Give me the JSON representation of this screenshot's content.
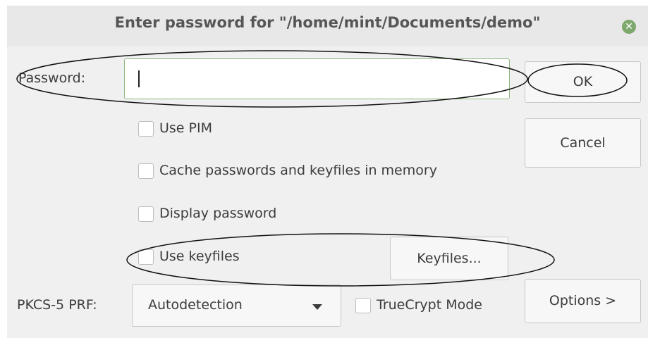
{
  "dialog": {
    "title": "Enter password for \"/home/mint/Documents/demo\"",
    "close_icon": "close-icon"
  },
  "password": {
    "label": "Password:",
    "value": ""
  },
  "buttons": {
    "ok": "OK",
    "cancel": "Cancel",
    "keyfiles": "Keyfiles...",
    "options": "Options >"
  },
  "checkboxes": {
    "use_pim": {
      "label": "Use PIM",
      "checked": false
    },
    "cache": {
      "label": "Cache passwords and keyfiles in memory",
      "checked": false
    },
    "display_password": {
      "label": "Display password",
      "checked": false
    },
    "use_keyfiles": {
      "label": "Use keyfiles",
      "checked": false
    },
    "truecrypt_mode": {
      "label": "TrueCrypt Mode",
      "checked": false
    }
  },
  "prf": {
    "label": "PKCS-5 PRF:",
    "selected": "Autodetection"
  },
  "colors": {
    "dialog_bg": "#f0f0f0",
    "input_focus_border": "#8fb67d",
    "close_button": "#7fa86e"
  }
}
